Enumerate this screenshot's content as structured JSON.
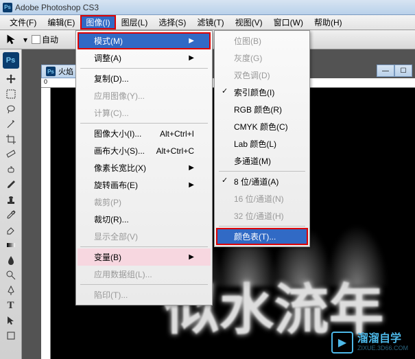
{
  "title": "Adobe Photoshop CS3",
  "menubar": [
    "文件(F)",
    "编辑(E)",
    "图像(I)",
    "图层(L)",
    "选择(S)",
    "滤镜(T)",
    "视图(V)",
    "窗口(W)",
    "帮助(H)"
  ],
  "active_menu_index": 2,
  "options": {
    "auto_select_label": "自动"
  },
  "doc_tab": "火焰",
  "ruler_zero": "0",
  "image_menu": [
    {
      "label": "模式(M)",
      "arrow": true,
      "highlighted": true
    },
    {
      "label": "调整(A)",
      "arrow": true
    },
    {
      "sep": true
    },
    {
      "label": "复制(D)...",
      "arrow": false
    },
    {
      "label": "应用图像(Y)...",
      "arrow": false,
      "disabled": true
    },
    {
      "label": "计算(C)...",
      "arrow": false,
      "disabled": true
    },
    {
      "sep": true
    },
    {
      "label": "图像大小(I)...",
      "shortcut": "Alt+Ctrl+I"
    },
    {
      "label": "画布大小(S)...",
      "shortcut": "Alt+Ctrl+C"
    },
    {
      "label": "像素长宽比(X)",
      "arrow": true
    },
    {
      "label": "旋转画布(E)",
      "arrow": true
    },
    {
      "label": "裁剪(P)",
      "disabled": true
    },
    {
      "label": "裁切(R)...",
      "arrow": false
    },
    {
      "label": "显示全部(V)",
      "disabled": true
    },
    {
      "sep": true
    },
    {
      "label": "变量(B)",
      "arrow": true,
      "pink": true
    },
    {
      "label": "应用数据组(L)...",
      "disabled": true
    },
    {
      "sep": true
    },
    {
      "label": "陷印(T)...",
      "disabled": true
    }
  ],
  "mode_submenu": [
    {
      "label": "位图(B)",
      "disabled": true
    },
    {
      "label": "灰度(G)",
      "disabled": true
    },
    {
      "label": "双色调(D)",
      "disabled": true
    },
    {
      "label": "索引颜色(I)",
      "checked": true
    },
    {
      "label": "RGB 颜色(R)"
    },
    {
      "label": "CMYK 颜色(C)"
    },
    {
      "label": "Lab 颜色(L)"
    },
    {
      "label": "多通道(M)"
    },
    {
      "sep": true
    },
    {
      "label": "8 位/通道(A)",
      "checked": true
    },
    {
      "label": "16 位/通道(N)",
      "disabled": true
    },
    {
      "label": "32 位/通道(H)",
      "disabled": true
    },
    {
      "sep": true
    },
    {
      "label": "颜色表(T)...",
      "highlighted": true
    }
  ],
  "fire_chars": [
    "似",
    "水",
    "流",
    "年"
  ],
  "watermark": {
    "title": "溜溜自学",
    "url": "ZIXUE.3D66.COM"
  }
}
